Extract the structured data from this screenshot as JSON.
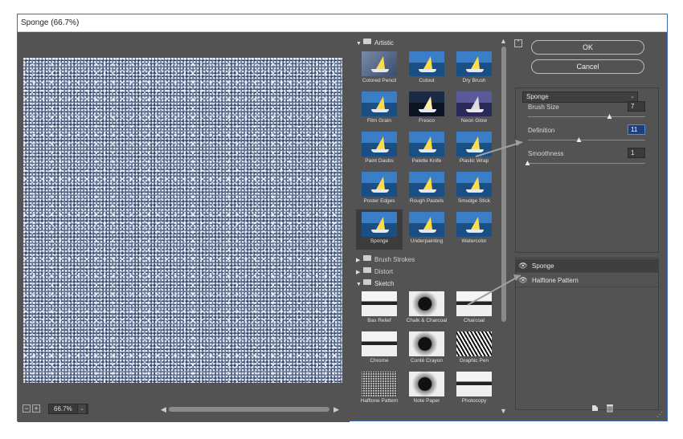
{
  "window": {
    "title": "Sponge (66.7%)"
  },
  "preview": {
    "zoom_value": "66.7%",
    "zoom_out_label": "−",
    "zoom_in_label": "+",
    "dropdown_glyph": "⌄",
    "scroll_left": "◀",
    "scroll_right": "▶"
  },
  "gallery": {
    "groups": [
      {
        "label": "Artistic",
        "expanded": true
      },
      {
        "label": "Brush Strokes",
        "expanded": false
      },
      {
        "label": "Distort",
        "expanded": false
      },
      {
        "label": "Sketch",
        "expanded": true
      }
    ],
    "artistic_filters": [
      "Colored Pencil",
      "Cutout",
      "Dry Brush",
      "Film Grain",
      "Fresco",
      "Neon Glow",
      "Paint Daubs",
      "Palette Knife",
      "Plastic Wrap",
      "Poster Edges",
      "Rough Pastels",
      "Smudge Stick",
      "Sponge",
      "Underpainting",
      "Watercolor"
    ],
    "sketch_filters": [
      "Bas Relief",
      "Chalk & Charcoal",
      "Charcoal",
      "Chrome",
      "Conté Crayon",
      "Graphic Pen",
      "Halftone Pattern",
      "Note Paper",
      "Photocopy"
    ],
    "selected_filter": "Sponge",
    "scroll_up": "▲",
    "scroll_down": "▼",
    "expanded_glyph": "▼",
    "collapsed_glyph": "▶"
  },
  "controls": {
    "ok_label": "OK",
    "cancel_label": "Cancel",
    "collapse_glyph": "⌃",
    "filter_select_value": "Sponge",
    "params": [
      {
        "label": "Brush Size",
        "value": "7",
        "level": 0.7
      },
      {
        "label": "Definition",
        "value": "11",
        "level": 0.44
      },
      {
        "label": "Smoothness",
        "value": "1",
        "level": 0.0
      }
    ]
  },
  "layers": {
    "items": [
      {
        "name": "Sponge",
        "selected": true
      },
      {
        "name": "Halftone Pattern",
        "selected": false
      }
    ],
    "new_icon": "new-layer-icon",
    "delete_icon": "trash-icon"
  },
  "colors": {
    "dialog_bg": "#535353",
    "accent": "#4a90e2",
    "title_border": "#3d6bb3"
  }
}
